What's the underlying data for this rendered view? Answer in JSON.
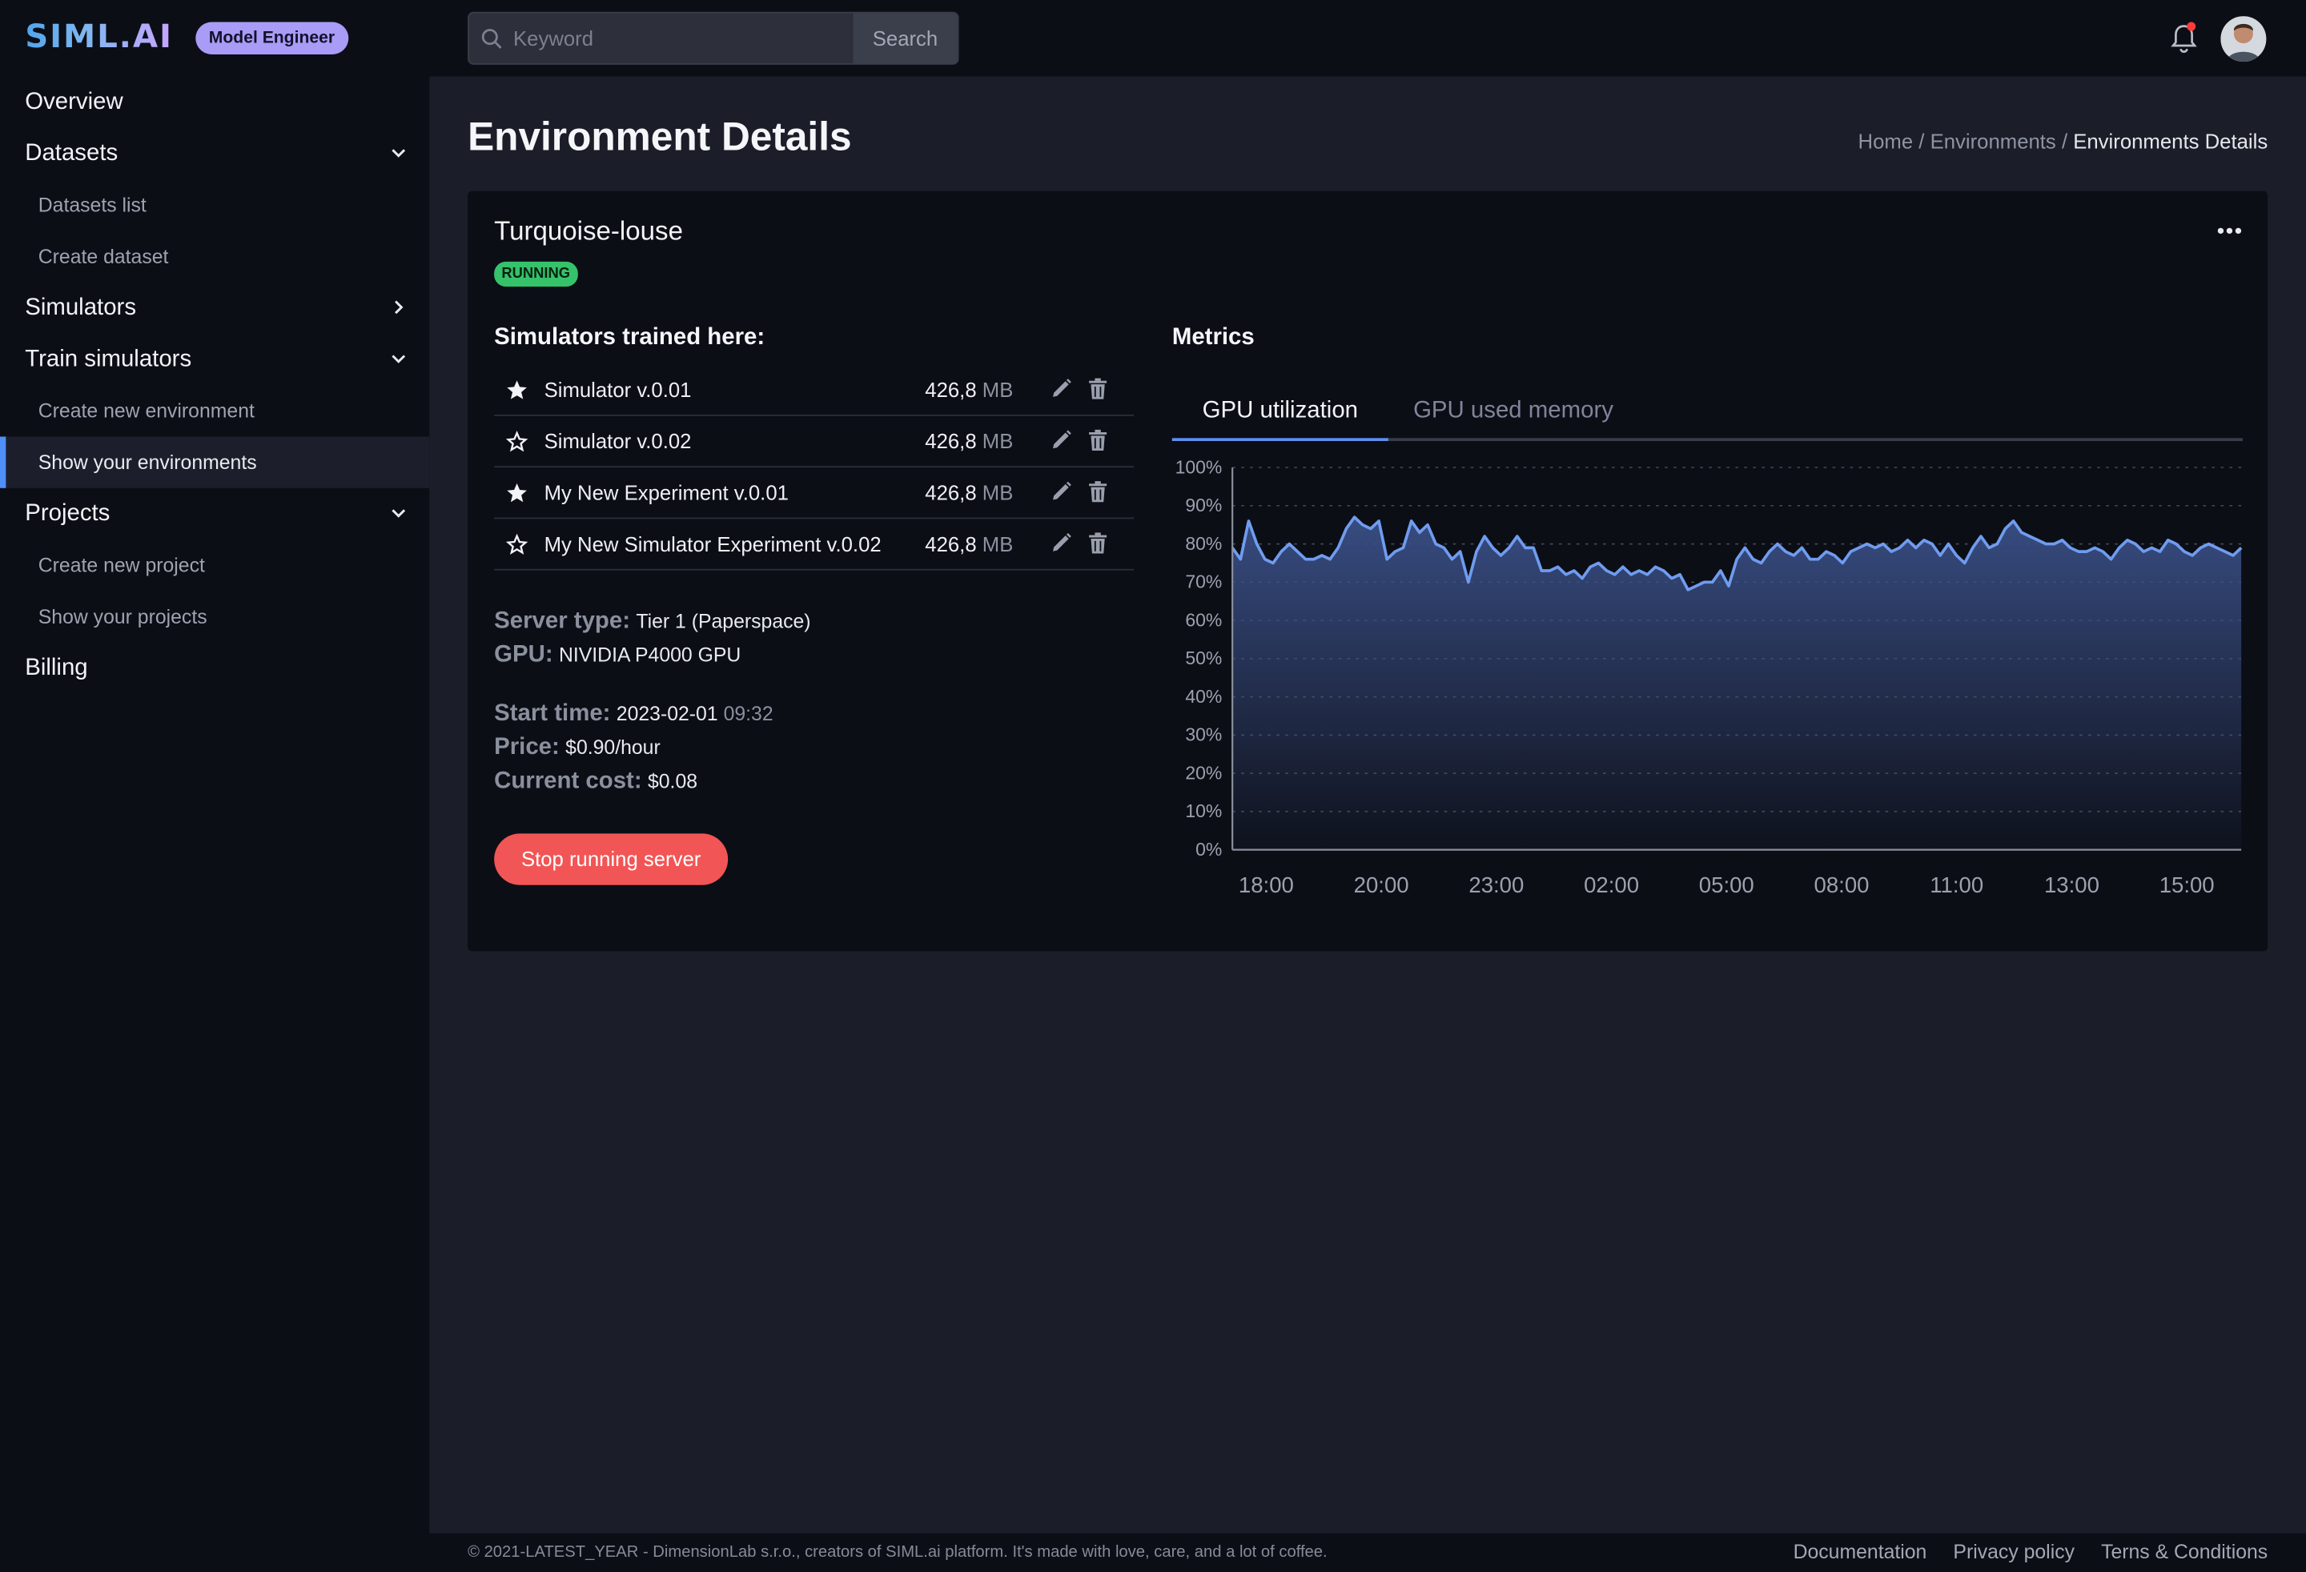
{
  "brand": {
    "logo": "SIML.AI",
    "role": "Model Engineer"
  },
  "search": {
    "placeholder": "Keyword",
    "button": "Search"
  },
  "nav": {
    "overview": "Overview",
    "datasets": "Datasets",
    "datasets_list": "Datasets list",
    "create_dataset": "Create dataset",
    "simulators": "Simulators",
    "train_simulators": "Train simulators",
    "create_env": "Create new environment",
    "show_envs": "Show your environments",
    "projects": "Projects",
    "create_project": "Create new project",
    "show_projects": "Show your projects",
    "billing": "Billing"
  },
  "page": {
    "title": "Environment Details"
  },
  "breadcrumb": {
    "home": "Home",
    "sep": "/",
    "envs": "Environments",
    "current": "Environments Details"
  },
  "env": {
    "name": "Turquoise-louse",
    "status": "RUNNING",
    "status_color": "#35c26a"
  },
  "simulators": {
    "title": "Simulators trained here:",
    "items": [
      {
        "name": "Simulator v.0.01",
        "size": "426,8",
        "unit": "MB",
        "starred": true
      },
      {
        "name": "Simulator v.0.02",
        "size": "426,8",
        "unit": "MB",
        "starred": false
      },
      {
        "name": "My New Experiment v.0.01",
        "size": "426,8",
        "unit": "MB",
        "starred": true
      },
      {
        "name": "My New Simulator Experiment v.0.02",
        "size": "426,8",
        "unit": "MB",
        "starred": false
      }
    ]
  },
  "info": {
    "server_label": "Server type:",
    "server": "Tier 1 (Paperspace)",
    "gpu_label": "GPU:",
    "gpu": "NIVIDIA P4000 GPU",
    "start_label": "Start time:",
    "start_date": "2023-02-01",
    "start_time": "09:32",
    "price_label": "Price:",
    "price": "$0.90/hour",
    "cost_label": "Current cost:",
    "cost": "$0.08"
  },
  "stop_button": "Stop running server",
  "metrics": {
    "title": "Metrics",
    "tabs": [
      "GPU utilization",
      "GPU used memory"
    ]
  },
  "chart_data": {
    "type": "area",
    "ylim": [
      0,
      100
    ],
    "yticks": [
      "100%",
      "90%",
      "80%",
      "70%",
      "60%",
      "50%",
      "40%",
      "30%",
      "20%",
      "10%",
      "0%"
    ],
    "xticks": [
      "18:00",
      "20:00",
      "23:00",
      "02:00",
      "05:00",
      "08:00",
      "11:00",
      "13:00",
      "15:00"
    ],
    "grid": true,
    "line_color": "#6f9cf0",
    "values": [
      79,
      76,
      86,
      80,
      76,
      75,
      78,
      80,
      78,
      76,
      76,
      77,
      76,
      79,
      84,
      87,
      85,
      84,
      86,
      76,
      78,
      79,
      86,
      83,
      85,
      80,
      79,
      76,
      78,
      70,
      78,
      82,
      79,
      77,
      79,
      82,
      79,
      79,
      73,
      73,
      74,
      72,
      73,
      71,
      74,
      75,
      73,
      72,
      74,
      72,
      73,
      72,
      74,
      73,
      71,
      72,
      68,
      69,
      70,
      70,
      73,
      69,
      76,
      79,
      76,
      75,
      78,
      80,
      78,
      77,
      79,
      76,
      76,
      78,
      77,
      75,
      78,
      79,
      80,
      79,
      80,
      78,
      79,
      81,
      79,
      81,
      80,
      77,
      80,
      77,
      75,
      79,
      82,
      79,
      80,
      84,
      86,
      83,
      82,
      81,
      80,
      80,
      81,
      79,
      78,
      78,
      79,
      78,
      76,
      79,
      81,
      80,
      78,
      79,
      78,
      81,
      80,
      78,
      77,
      79,
      80,
      79,
      78,
      77,
      79
    ],
    "note": "values are % GPU utilization over time (18:00 to ~16:00)"
  },
  "footer": {
    "copyright": "© 2021-LATEST_YEAR - DimensionLab s.r.o., creators of SIML.ai platform. It's made with love, care, and a lot of coffee.",
    "links": [
      "Documentation",
      "Privacy policy",
      "Terns & Conditions"
    ]
  }
}
